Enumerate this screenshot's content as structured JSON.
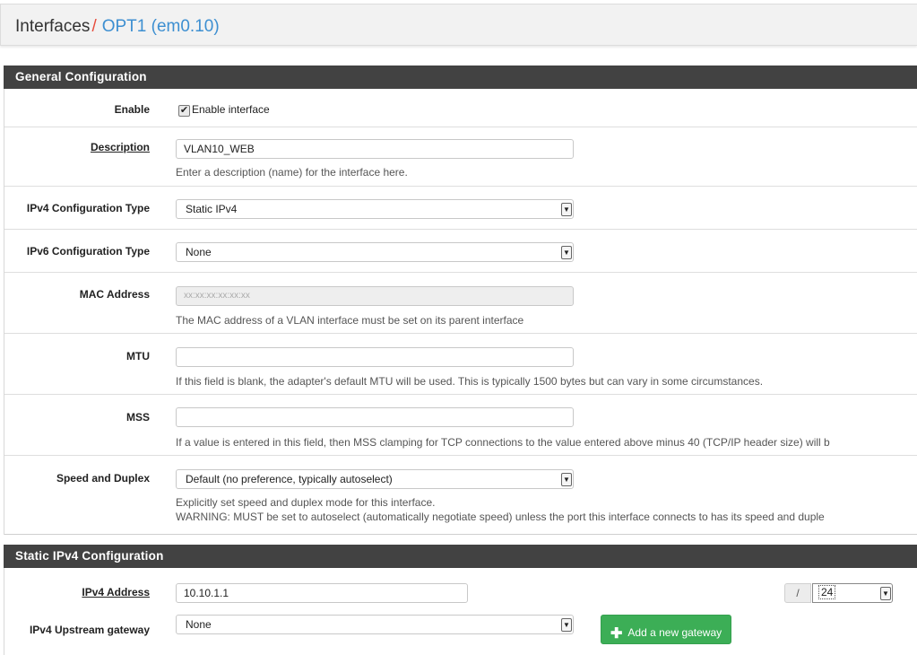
{
  "breadcrumb": {
    "parent": "Interfaces",
    "separator": "/",
    "current": "OPT1 (em0.10)"
  },
  "general": {
    "heading": "General Configuration",
    "enable": {
      "label": "Enable",
      "checkbox_label": "Enable interface",
      "checked": true
    },
    "description": {
      "label": "Description",
      "value": "VLAN10_WEB",
      "help": "Enter a description (name) for the interface here."
    },
    "ipv4_type": {
      "label": "IPv4 Configuration Type",
      "value": "Static IPv4"
    },
    "ipv6_type": {
      "label": "IPv6 Configuration Type",
      "value": "None"
    },
    "mac": {
      "label": "MAC Address",
      "placeholder": "xx:xx:xx:xx:xx:xx",
      "help": "The MAC address of a VLAN interface must be set on its parent interface"
    },
    "mtu": {
      "label": "MTU",
      "value": "",
      "help": "If this field is blank, the adapter's default MTU will be used. This is typically 1500 bytes but can vary in some circumstances."
    },
    "mss": {
      "label": "MSS",
      "value": "",
      "help": "If a value is entered in this field, then MSS clamping for TCP connections to the value entered above minus 40 (TCP/IP header size) will b"
    },
    "speed": {
      "label": "Speed and Duplex",
      "value": "Default (no preference, typically autoselect)",
      "help1": "Explicitly set speed and duplex mode for this interface.",
      "help2": "WARNING: MUST be set to autoselect (automatically negotiate speed) unless the port this interface connects to has its speed and duple"
    }
  },
  "static_ipv4": {
    "heading": "Static IPv4 Configuration",
    "address": {
      "label": "IPv4 Address",
      "value": "10.10.1.1",
      "slash": "/",
      "cidr": "24"
    },
    "gateway": {
      "label": "IPv4 Upstream gateway",
      "value": "None",
      "add_button": "Add a new gateway"
    }
  },
  "icons": {
    "dropdown": "dropdown-arrow-icon",
    "spinner": "spinner-icon",
    "plus": "plus-icon",
    "check": "checkmark-icon"
  },
  "colors": {
    "heading_bg": "#424242",
    "accent_blue": "#3d8fd1",
    "separator_red": "#e74c3c",
    "button_green": "#3cae56"
  }
}
